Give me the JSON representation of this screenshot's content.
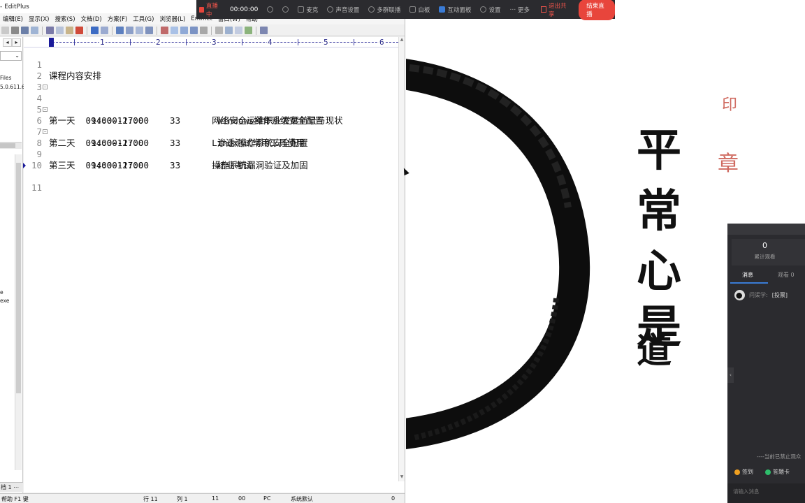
{
  "editor": {
    "title": "- EditPlus",
    "window_buttons": [
      "–",
      "□",
      "✕"
    ],
    "menu": [
      "编辑(E)",
      "显示(X)",
      "搜索(S)",
      "文档(D)",
      "方案(F)",
      "工具(G)",
      "浏览器(L)",
      "Emmet",
      "窗口(W)",
      "帮助"
    ],
    "left_panel": {
      "back": "◂",
      "forward": "▸",
      "drive_value": "⌄",
      "tree_items": [
        "Files",
        "5.0.611.6"
      ],
      "file_items": [
        "e",
        "exe"
      ],
      "bottom_tab": "档 1  ⋯"
    },
    "ruler_numbers": [
      "1",
      "2",
      "3",
      "4",
      "5",
      "6"
    ],
    "lines": [
      {
        "num": "1",
        "text": "课程内容安排",
        "fold": false
      },
      {
        "num": "2",
        "text": "",
        "fold": false
      },
      {
        "num": "3",
        "text": "",
        "fold": false
      },
      {
        "num": "4",
        "text": "第一天  09:00-12:00     3       网络安全运维职业发展前景与现状",
        "fold": true
      },
      {
        "num": "5",
        "text": "        14:00-17:00     3       Windows操作系统安全配置",
        "fold": false
      },
      {
        "num": "6",
        "text": "第二天  09:00-12:00     3       Linux操作系统安全配置",
        "fold": true
      },
      {
        "num": "7",
        "text": "        14:00-17:00     3       渗透测试常用工具使用",
        "fold": false
      },
      {
        "num": "8",
        "text": "第三天  09:00-12:00     3       操作系统漏洞验证及加固",
        "fold": true
      },
      {
        "num": "9",
        "text": "        14:00-17:00     3       结业考试",
        "fold": false
      },
      {
        "num": "10",
        "text": "",
        "fold": false
      },
      {
        "num": "11",
        "text": "",
        "fold": false
      }
    ],
    "fold_glyph": "⊟",
    "status": {
      "hint": "帮助 F1 键",
      "row": "行 11",
      "col": "列 1",
      "total": "11",
      "code": "00",
      "mode": "PC",
      "encoding": "系统默认",
      "zero": "0"
    }
  },
  "wallpaper": {
    "characters": [
      "平",
      "常",
      "心",
      "是",
      "道"
    ],
    "seal_top": "印",
    "seal_mid": "章"
  },
  "live_bar": {
    "status": "直播中",
    "timer": "00:00:00",
    "items": [
      "麦克",
      "声音设置",
      "多群联播",
      "白板",
      "互动面板",
      "设置",
      "更多"
    ],
    "exit": "退出共享",
    "end": "结束直播"
  },
  "side_panel": {
    "viewer_count": "0",
    "viewer_label": "累计观看",
    "tab_messages": "消息",
    "tab_viewers": "观看 0",
    "message": {
      "user": "问渠学:",
      "content": "[投票]"
    },
    "notice": "----当前已禁止观众",
    "sign_in": "签到",
    "answer": "答题卡",
    "input_placeholder": "请输入消息",
    "handle": "‹"
  },
  "colors": {
    "live_red": "#e8453c",
    "panel_bg": "#2b2b2f",
    "accent_blue": "#3a7bd5",
    "ruler_blue": "#3a3aa0"
  }
}
